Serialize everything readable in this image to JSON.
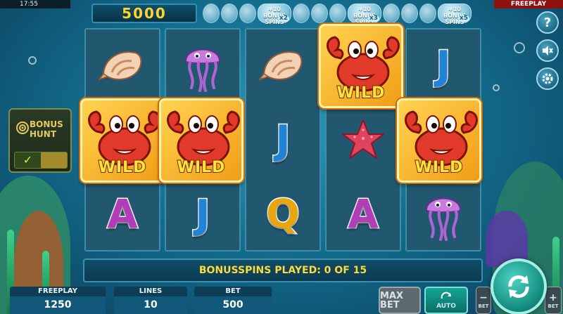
{
  "status_bar": {
    "time": "17:55",
    "mode": "FREEPLAY"
  },
  "counter": {
    "value": "5000"
  },
  "progress": {
    "milestones": [
      {
        "text": "+10 BONUS SPINS",
        "multiplier": "x2"
      },
      {
        "text": "+10 BONUS SPINS",
        "multiplier": "x3"
      },
      {
        "text": "+10 BONUS SPINS",
        "multiplier": "x5"
      }
    ]
  },
  "bonus_hunt": {
    "label": "BONUS HUNT",
    "state": "✓"
  },
  "reels": [
    [
      "shell",
      "wild",
      "letter-a"
    ],
    [
      "jellyfish",
      "wild",
      "letter-j"
    ],
    [
      "shell",
      "letter-j",
      "letter-q"
    ],
    [
      "wild",
      "starfish",
      "letter-a"
    ],
    [
      "letter-j",
      "wild",
      "jellyfish"
    ]
  ],
  "symbols": {
    "wild_label": "WILD",
    "letter_a": "A",
    "letter_j": "J",
    "letter_q": "Q"
  },
  "message": "BONUSSPINS PLAYED: 0 OF 15",
  "panels": {
    "freeplay": {
      "title": "FREEPLAY",
      "value": "1250"
    },
    "lines": {
      "title": "LINES",
      "value": "10"
    },
    "bet": {
      "title": "BET",
      "value": "500"
    }
  },
  "buttons": {
    "max_bet": "MAX BET",
    "auto": "AUTO",
    "bet_minus": "BET",
    "bet_plus": "BET"
  },
  "icons": [
    "help-icon",
    "sound-off-icon",
    "settings-icon",
    "spin-icon",
    "auto-icon",
    "target-icon"
  ],
  "colors": {
    "accent_yellow": "#ffd93a",
    "reel_bg": "#22586f",
    "wild_gold": "#f19d16",
    "freeplay_red": "#8f1010"
  }
}
